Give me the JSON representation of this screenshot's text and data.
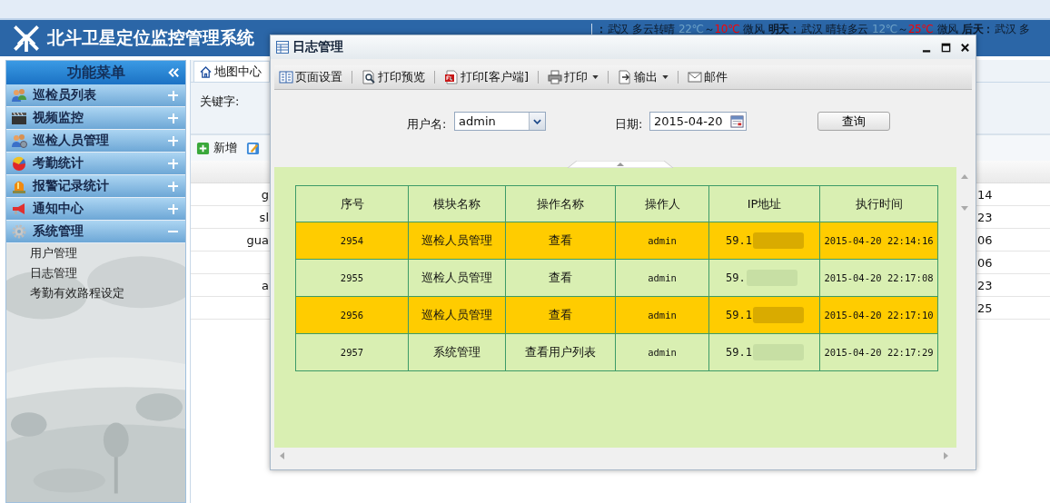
{
  "header": {
    "title": "北斗卫星定位监控管理系统"
  },
  "weather": [
    {
      "day": "：",
      "city": "武汉",
      "sky": "多云转晴",
      "temp_low": "22℃",
      "temp_sep": "～",
      "temp_high": "10℃",
      "wind": "微风"
    },
    {
      "day": "明天：",
      "city": "武汉",
      "sky": "晴转多云",
      "temp_low": "12℃",
      "temp_sep": "～",
      "temp_high": "25℃",
      "wind": "微风"
    },
    {
      "day": "后天：",
      "city": "武汉",
      "sky": "多"
    }
  ],
  "sidebar": {
    "title": "功能菜单",
    "sections": [
      {
        "label": "巡检员列表",
        "expanded": false
      },
      {
        "label": "视频监控",
        "expanded": false
      },
      {
        "label": "巡检人员管理",
        "expanded": false
      },
      {
        "label": "考勤统计",
        "expanded": false
      },
      {
        "label": "报警记录统计",
        "expanded": false
      },
      {
        "label": "通知中心",
        "expanded": false
      },
      {
        "label": "系统管理",
        "expanded": true,
        "children": [
          {
            "label": "用户管理"
          },
          {
            "label": "日志管理"
          },
          {
            "label": "考勤有效路程设定"
          }
        ]
      }
    ]
  },
  "main": {
    "tab": "地图中心",
    "keyword_label": "关键字:",
    "toolbar": [
      {
        "label": "新增"
      }
    ],
    "rows": [
      {
        "column_1": "g",
        "column_2": "14"
      },
      {
        "column_1": "sl",
        "column_2": "23"
      },
      {
        "column_1": "gua",
        "column_2": "06"
      },
      {
        "column_2": "06"
      },
      {
        "column_1": "a",
        "column_2": "23"
      },
      {
        "column_2": "25"
      }
    ]
  },
  "dialog": {
    "title": "日志管理",
    "toolbar": [
      {
        "label": "页面设置",
        "dropdown": false
      },
      {
        "label": "打印预览",
        "dropdown": false
      },
      {
        "label": "打印[客户端]",
        "dropdown": false
      },
      {
        "label": "打印",
        "dropdown": true
      },
      {
        "label": "输出",
        "dropdown": true
      },
      {
        "label": "邮件",
        "dropdown": false
      }
    ],
    "form": {
      "user_label": "用户名:",
      "user": "admin",
      "date_label": "日期:",
      "date": "2015-04-20",
      "query": "查询"
    },
    "table": {
      "columns": [
        "序号",
        "模块名称",
        "操作名称",
        "操作人",
        "IP地址",
        "执行时间"
      ],
      "rows": [
        {
          "cells": [
            "2954",
            "巡检人员管理",
            "查看",
            "admin",
            "59.1",
            "2015-04-20 22:14:16"
          ],
          "highlighted": true
        },
        {
          "cells": [
            "2955",
            "巡检人员管理",
            "查看",
            "admin",
            "59.",
            "2015-04-20 22:17:08"
          ],
          "highlighted": false
        },
        {
          "cells": [
            "2956",
            "巡检人员管理",
            "查看",
            "admin",
            "59.1",
            "2015-04-20 22:17:10"
          ],
          "highlighted": true
        },
        {
          "cells": [
            "2957",
            "系统管理",
            "查看用户列表",
            "admin",
            "59.1",
            "2015-04-20 22:17:29"
          ],
          "highlighted": false
        }
      ]
    }
  }
}
